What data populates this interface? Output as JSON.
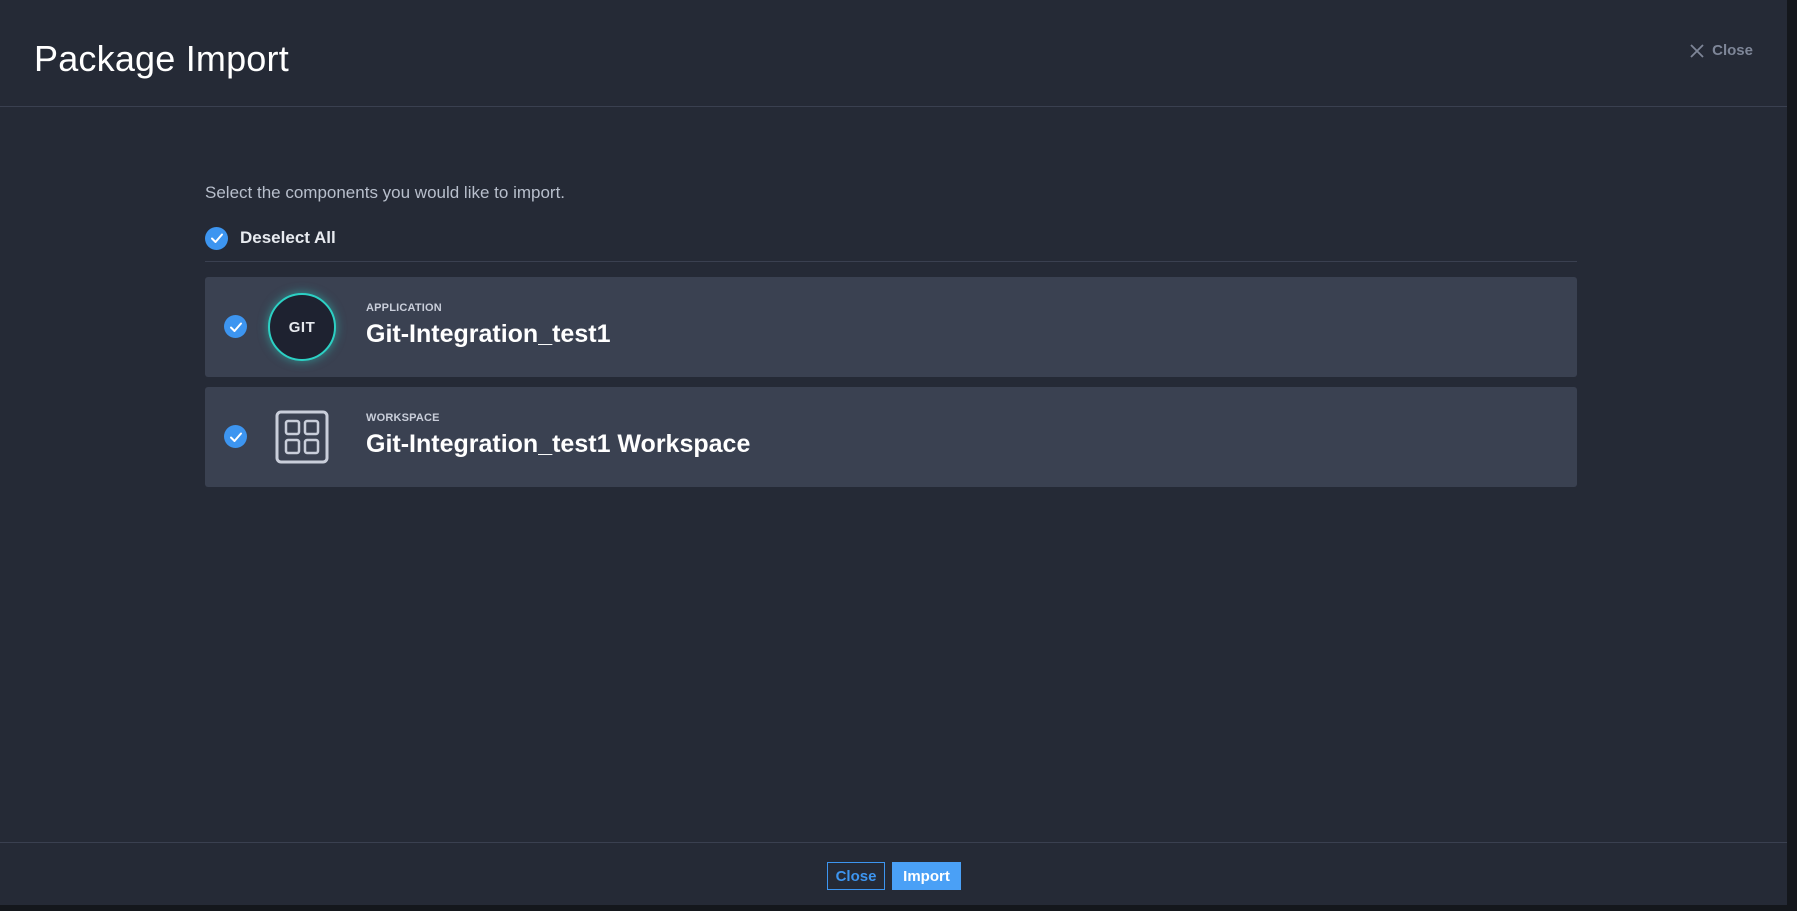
{
  "dialog": {
    "title": "Package Import",
    "close_label": "Close"
  },
  "content": {
    "instruction": "Select the components you would like to import.",
    "select_all_label": "Deselect All",
    "select_all_checked": true
  },
  "items": [
    {
      "type": "APPLICATION",
      "name": "Git-Integration_test1",
      "icon": "git-badge-icon",
      "icon_text": "GIT",
      "checked": true
    },
    {
      "type": "WORKSPACE",
      "name": "Git-Integration_test1 Workspace",
      "icon": "workspace-grid-icon",
      "checked": true
    }
  ],
  "footer": {
    "close_label": "Close",
    "import_label": "Import"
  },
  "colors": {
    "accent": "#3d95f0",
    "background": "#252a36",
    "item_background": "#3a4151",
    "git_ring": "#2cd1c4"
  }
}
